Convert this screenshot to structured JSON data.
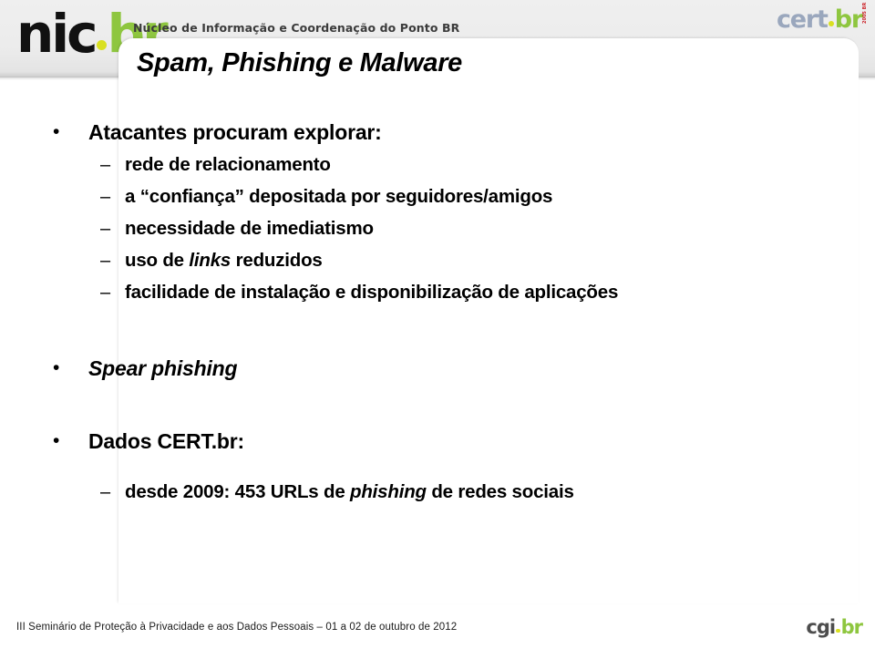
{
  "header": {
    "nicbr_logo": {
      "part1": "nic",
      "dot": "·",
      "part2": "br"
    },
    "tagline": "Núcleo de Informação e Coordenação do Ponto BR",
    "certbr_logo": {
      "part1": "cert",
      "dot": "·",
      "part2": "br",
      "vertical": "2005 BR"
    }
  },
  "slide": {
    "title": "Spam, Phishing e Malware",
    "bullets": [
      {
        "level": 1,
        "marker": "•",
        "text": "Atacantes procuram explorar:",
        "italic": false
      },
      {
        "level": 2,
        "marker": "–",
        "text": "rede de relacionamento"
      },
      {
        "level": 2,
        "marker": "–",
        "text": "a “confiança” depositada por seguidores/amigos"
      },
      {
        "level": 2,
        "marker": "–",
        "text": "necessidade de imediatismo"
      },
      {
        "level": 2,
        "marker": "–",
        "text": "uso de links reduzidos",
        "italic_words": [
          "links"
        ]
      },
      {
        "level": 2,
        "marker": "–",
        "text": "facilidade de instalação e disponibilização de aplicações"
      },
      {
        "level": 1,
        "marker": "•",
        "text": "Spear phishing",
        "italic": true
      },
      {
        "level": 1,
        "marker": "•",
        "text": "Dados CERT.br:",
        "italic": false
      },
      {
        "level": 2,
        "marker": "–",
        "text": "desde 2009: 453 URLs de phishing de redes sociais",
        "italic_words": [
          "phishing"
        ]
      }
    ]
  },
  "footer": {
    "text": "III Seminário de Proteção à Privacidade e aos Dados Pessoais – 01 a 02 de outubro de 2012",
    "cgibr_logo": {
      "part1": "cgi",
      "dot": "·",
      "part2": "br"
    }
  },
  "colors": {
    "green": "#8ec63f",
    "dot_yellow": "#d9e021",
    "cert_gray_blue": "#9aa7bd",
    "cert_red": "#cc2229",
    "header_gray": "#ececec"
  }
}
